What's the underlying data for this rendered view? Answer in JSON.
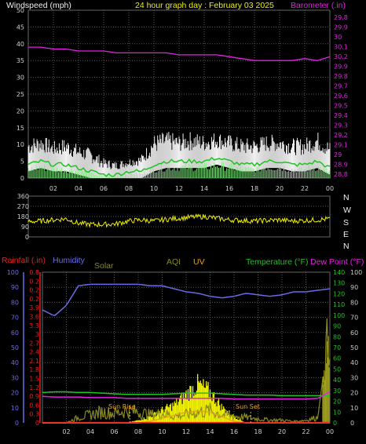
{
  "header": {
    "left": "Windspeed (mph)",
    "center": "24 hour graph day : February 03 2025",
    "right": "Barometer (.in)"
  },
  "legend": {
    "rainfall": "Rainfall (.in)",
    "humidity": "Humidity",
    "solar": "Solar",
    "aqi": "AQI",
    "uv": "UV",
    "temperature": "Temperature (°F)",
    "dewpoint": "Dew Point (°F)"
  },
  "annotations": {
    "sunrise": "Sun Rise",
    "sunset": "Sun Set"
  },
  "colors": {
    "background": "#000000",
    "grid": "#5a5a5a",
    "barometer": "#e81ee8",
    "wind_gust": "#f0f0f0",
    "wind_avg": "#1fc41f",
    "wind_band": "#8af08a",
    "direction": "#f0f000",
    "humidity": "#6a6ae8",
    "temperature": "#1fc41f",
    "dewpoint": "#e81ee8",
    "solar": "#f0f000",
    "aqi": "#8a8a20",
    "uv": "#e8a020",
    "rainfall": "#e81e1e",
    "title_text": "#f0f000",
    "left_axis": "#6a6ae8",
    "rain_axis": "#e81e1e",
    "temp_axis": "#1fc41f"
  },
  "chart_data": [
    {
      "type": "line",
      "panel": "wind_barometer",
      "title": "24 hour graph day : February 03 2025",
      "x_ticks": [
        "02",
        "04",
        "06",
        "08",
        "10",
        "12",
        "14",
        "16",
        "18",
        "20",
        "22",
        "00"
      ],
      "x_range": [
        0,
        24
      ],
      "ylabel": "Windspeed (mph)",
      "ylim": [
        0,
        50
      ],
      "y_ticks": [
        "0",
        "5",
        "10",
        "15",
        "20",
        "25",
        "30",
        "35",
        "40",
        "45",
        "50"
      ],
      "y2label": "Barometer (.in)",
      "y2lim": [
        29.8,
        30.25
      ],
      "y2_ticks": [
        "29.8",
        "29.9",
        "30",
        "30.1",
        "30.2",
        "29.9",
        "29.8",
        "29.7",
        "29.6",
        "29.5",
        "29.4",
        "29.3",
        "29.2",
        "29.1",
        "29",
        "28.9",
        "28.8"
      ],
      "series": [
        {
          "name": "Barometer (.in)",
          "x": [
            0,
            1,
            2,
            3,
            4,
            5,
            6,
            7,
            8,
            9,
            10,
            11,
            12,
            13,
            14,
            15,
            16,
            17,
            18,
            19,
            20,
            21,
            22,
            23,
            24
          ],
          "values": [
            30.04,
            30.04,
            30.03,
            30.03,
            30.02,
            30.02,
            30.02,
            30.01,
            30.01,
            30.01,
            30.01,
            30.01,
            30.0,
            30.0,
            30.0,
            30.0,
            29.99,
            29.98,
            29.97,
            29.97,
            29.97,
            29.97,
            29.98,
            29.97,
            29.99
          ]
        },
        {
          "name": "Gust",
          "x": [
            0,
            1,
            2,
            3,
            4,
            5,
            6,
            7,
            8,
            9,
            10,
            11,
            12,
            13,
            14,
            15,
            16,
            17,
            18,
            19,
            20,
            21,
            22,
            23,
            24
          ],
          "values": [
            12,
            13,
            11,
            12,
            10,
            9,
            6,
            5,
            6,
            7,
            13,
            14,
            13,
            14,
            13,
            14,
            13,
            12,
            12,
            13,
            13,
            12,
            12,
            14,
            11
          ]
        },
        {
          "name": "Average",
          "x": [
            0,
            1,
            2,
            3,
            4,
            5,
            6,
            7,
            8,
            9,
            10,
            11,
            12,
            13,
            14,
            15,
            16,
            17,
            18,
            19,
            20,
            21,
            22,
            23,
            24
          ],
          "values": [
            4,
            5,
            4,
            4,
            3,
            2,
            1,
            1,
            2,
            2,
            4,
            5,
            5,
            5,
            5,
            6,
            5,
            4,
            4,
            5,
            5,
            4,
            4,
            5,
            3
          ]
        }
      ]
    },
    {
      "type": "line",
      "panel": "wind_direction",
      "x_ticks": [
        "02",
        "04",
        "06",
        "08",
        "10",
        "12",
        "14",
        "16",
        "18",
        "20",
        "22",
        "00"
      ],
      "x_range": [
        0,
        24
      ],
      "ylim": [
        0,
        360
      ],
      "y_ticks": [
        "0",
        "90",
        "180",
        "270",
        "360"
      ],
      "y_ticks_right": [
        "N",
        "E",
        "S",
        "W",
        "N"
      ],
      "series": [
        {
          "name": "Direction",
          "x": [
            0,
            1,
            2,
            3,
            4,
            5,
            6,
            7,
            8,
            9,
            10,
            11,
            12,
            13,
            14,
            15,
            16,
            17,
            18,
            19,
            20,
            21,
            22,
            23,
            24
          ],
          "values": [
            135,
            140,
            150,
            160,
            120,
            110,
            110,
            115,
            140,
            150,
            140,
            155,
            165,
            175,
            180,
            165,
            150,
            145,
            140,
            145,
            150,
            140,
            145,
            150,
            160
          ]
        }
      ]
    },
    {
      "type": "line",
      "panel": "weather",
      "x_ticks": [
        "02",
        "04",
        "06",
        "08",
        "10",
        "12",
        "14",
        "16",
        "18",
        "20",
        "22",
        "00"
      ],
      "x_range": [
        0,
        24
      ],
      "ylim": [
        0,
        100
      ],
      "y_ticks_left": [
        "0",
        "10",
        "20",
        "30",
        "40",
        "50",
        "60",
        "70",
        "80",
        "90",
        "100"
      ],
      "rain_ticks": [
        "0",
        "0.3",
        "0.6",
        "0.9",
        "1.2",
        "1.5",
        "1.8",
        "2.1",
        "2.4",
        "2.7",
        "3",
        "3.3",
        "3.6",
        "3.9",
        "0.2",
        "0.2",
        "0.2",
        "0.8"
      ],
      "temp_ticks": [
        "0",
        "10",
        "20",
        "30",
        "40",
        "50",
        "60",
        "70",
        "80",
        "90",
        "100",
        "110",
        "120",
        "130",
        "140"
      ],
      "temp_ticks_far": [
        "0",
        "10",
        "20",
        "30",
        "40",
        "50",
        "60",
        "70",
        "80",
        "90",
        "100"
      ],
      "series": [
        {
          "name": "Humidity",
          "x": [
            0,
            1,
            2,
            3,
            4,
            5,
            6,
            7,
            8,
            9,
            10,
            11,
            12,
            13,
            14,
            15,
            16,
            17,
            18,
            19,
            20,
            21,
            22,
            23,
            24
          ],
          "values": [
            75,
            71,
            78,
            91,
            92,
            92,
            92,
            92,
            92,
            91,
            91,
            89,
            87,
            86,
            84,
            83,
            84,
            86,
            85,
            84,
            85,
            87,
            87,
            88,
            89
          ]
        },
        {
          "name": "Temperature (°F)",
          "x": [
            0,
            1,
            2,
            3,
            4,
            5,
            6,
            7,
            8,
            9,
            10,
            11,
            12,
            13,
            14,
            15,
            16,
            17,
            18,
            19,
            20,
            21,
            22,
            23,
            24
          ],
          "values": [
            47,
            48,
            48,
            47,
            47,
            46,
            45,
            44,
            44,
            44,
            44,
            45,
            46,
            46,
            46,
            45,
            44,
            43,
            43,
            43,
            42,
            42,
            42,
            42,
            42
          ]
        },
        {
          "name": "Dew Point (°F)",
          "x": [
            0,
            1,
            2,
            3,
            4,
            5,
            6,
            7,
            8,
            9,
            10,
            11,
            12,
            13,
            14,
            15,
            16,
            17,
            18,
            19,
            20,
            21,
            22,
            23,
            24
          ],
          "values": [
            41,
            40,
            40,
            40,
            39,
            39,
            39,
            38,
            38,
            38,
            38,
            38,
            38,
            38,
            38,
            38,
            37,
            37,
            37,
            37,
            37,
            37,
            37,
            38,
            48
          ]
        },
        {
          "name": "Solar",
          "x": [
            0,
            1,
            2,
            3,
            4,
            5,
            6,
            7,
            8,
            9,
            10,
            11,
            12,
            13,
            14,
            15,
            16,
            17,
            18,
            19,
            20,
            21,
            22,
            23,
            24
          ],
          "values": [
            0,
            0,
            0,
            0,
            0,
            0,
            0,
            0,
            2,
            5,
            10,
            14,
            22,
            30,
            24,
            12,
            5,
            0,
            0,
            0,
            0,
            0,
            0,
            0,
            0
          ]
        },
        {
          "name": "AQI",
          "x": [
            0,
            1,
            2,
            3,
            4,
            5,
            6,
            7,
            8,
            9,
            10,
            11,
            12,
            13,
            14,
            15,
            16,
            17,
            18,
            19,
            20,
            21,
            22,
            23,
            24
          ],
          "values": [
            0,
            0,
            0,
            4,
            6,
            8,
            7,
            9,
            8,
            6,
            7,
            5,
            6,
            8,
            9,
            6,
            5,
            4,
            3,
            2,
            2,
            1,
            2,
            4,
            65
          ]
        },
        {
          "name": "UV",
          "x": [
            0,
            1,
            2,
            3,
            4,
            5,
            6,
            7,
            8,
            9,
            10,
            11,
            12,
            13,
            14,
            15,
            16,
            17,
            18,
            19,
            20,
            21,
            22,
            23,
            24
          ],
          "values": [
            0,
            0,
            0,
            0,
            0,
            0,
            0,
            0,
            0,
            1,
            3,
            5,
            7,
            8,
            7,
            4,
            1,
            0,
            0,
            0,
            0,
            0,
            0,
            0,
            0
          ]
        }
      ],
      "sunrise_hour": 7.3,
      "sunset_hour": 17.4
    }
  ]
}
